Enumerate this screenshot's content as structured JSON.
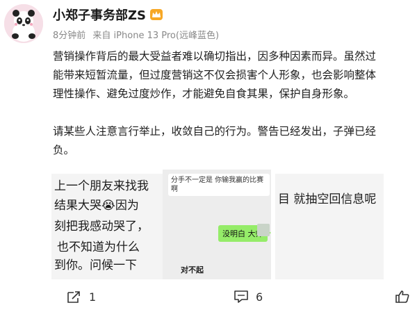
{
  "user": {
    "name": "小郑子事务部ZS",
    "badge_icon": "vip-crown-icon"
  },
  "meta": {
    "time": "8分钟前",
    "source": "来自 iPhone 13 Pro(远峰蓝色)"
  },
  "post": {
    "paragraphs": [
      "营销操作背后的最大受益者难以确切指出，因多种因素而异。虽然过",
      "能带来短暂流量，但过度营销这不仅会损害个人形象，也会影响整体",
      "理性操作、避免过度炒作，才能避免自食其果，保护自身形象。"
    ],
    "paragraphs2": [
      "请某些人注意言行举止，收敛自己的行为。警告已经发出，子弹已经",
      "负。"
    ]
  },
  "images": {
    "img1_lines": [
      "上一个朋友来找我",
      "结果大哭😭因为",
      "刻把我感动哭了，",
      "也不知道为什么",
      "到你。问候一下"
    ],
    "img2": {
      "top_message": "分手不一定是 你输我赢的比赛啊",
      "green_message": "没明白 大师",
      "handwritten": "对不起"
    },
    "img3_line": "目 就抽空回信息呢"
  },
  "actions": {
    "share_count": "1",
    "comment_count": "6",
    "like_count": ""
  }
}
